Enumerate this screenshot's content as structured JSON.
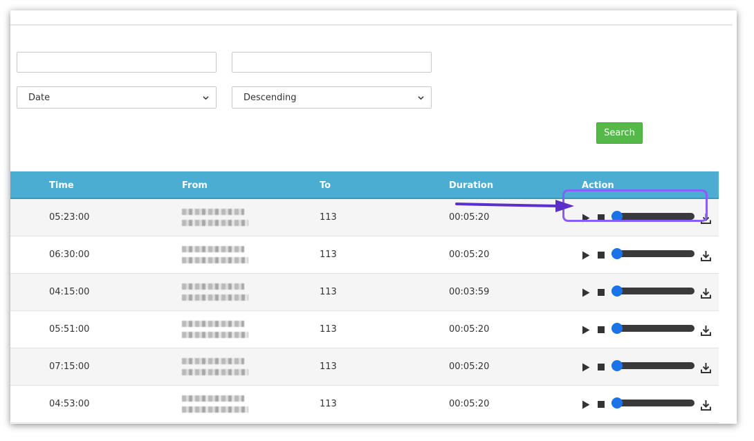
{
  "filters": {
    "text_field_1": {
      "value": "",
      "placeholder": ""
    },
    "text_field_2": {
      "value": "",
      "placeholder": ""
    },
    "sort_by": {
      "selected": "Date"
    },
    "sort_order": {
      "selected": "Descending"
    },
    "search_label": "Search"
  },
  "table": {
    "headers": {
      "time": "Time",
      "from": "From",
      "to": "To",
      "duration": "Duration",
      "action": "Action"
    },
    "rows": [
      {
        "time": "05:23:00",
        "to": "113",
        "duration": "00:05:20",
        "progress": 0
      },
      {
        "time": "06:30:00",
        "to": "113",
        "duration": "00:05:20",
        "progress": 0
      },
      {
        "time": "04:15:00",
        "to": "113",
        "duration": "00:03:59",
        "progress": 0
      },
      {
        "time": "05:51:00",
        "to": "113",
        "duration": "00:05:20",
        "progress": 0
      },
      {
        "time": "07:15:00",
        "to": "113",
        "duration": "00:05:20",
        "progress": 0
      },
      {
        "time": "04:53:00",
        "to": "113",
        "duration": "00:05:20",
        "progress": 0
      }
    ]
  },
  "icons": {
    "play": "play-icon",
    "stop": "stop-icon",
    "download": "download-icon",
    "chevron": "chevron-down-icon"
  },
  "colors": {
    "header": "#4badd1",
    "search_button": "#54b948",
    "slider_thumb": "#1a73e8",
    "annotation": "#8b5cf6"
  }
}
